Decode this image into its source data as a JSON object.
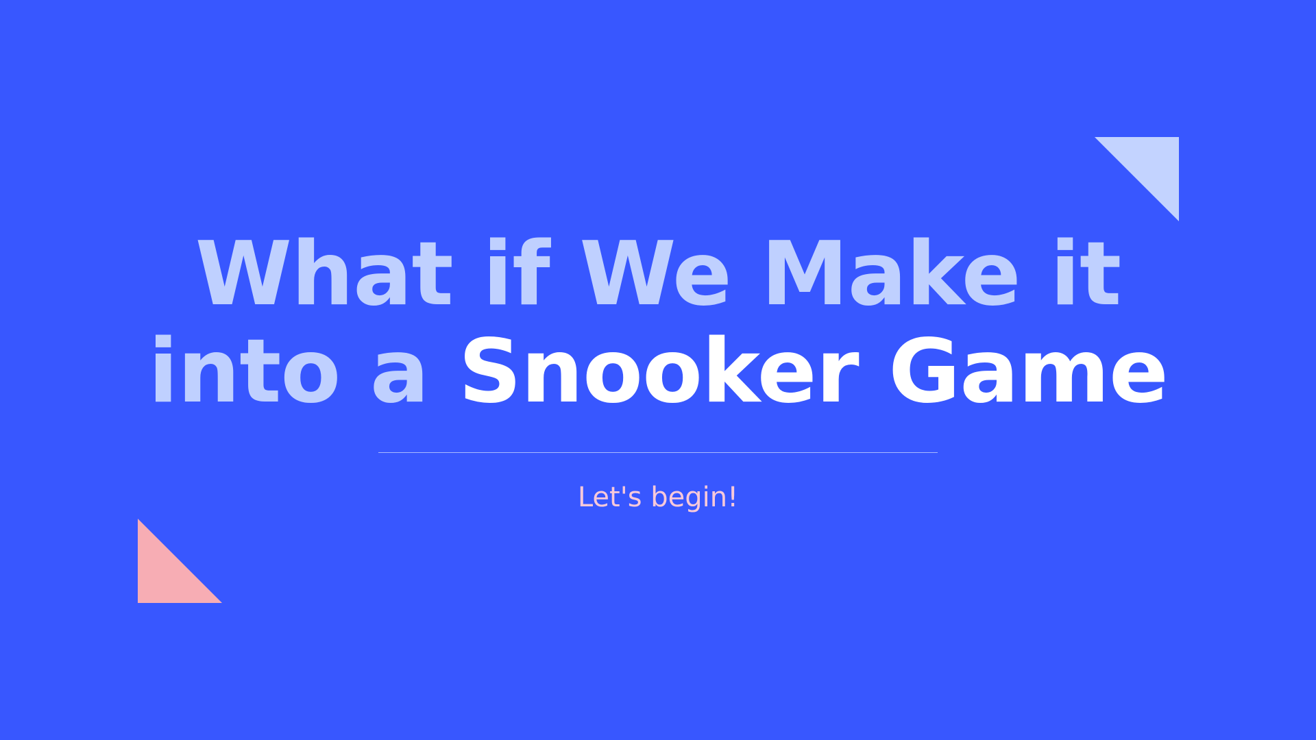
{
  "slide": {
    "title_line1": "What if We Make it",
    "title_line2_light": "into a",
    "title_line2_bold": "Snooker Game",
    "subtitle": "Let's begin!"
  },
  "colors": {
    "background": "#3857FF",
    "title_light": "#BFD0FF",
    "title_bold": "#FFFFFF",
    "subtitle": "#F8C9DA",
    "triangle_top_right": "#C3D3FF",
    "triangle_bottom_left": "#F7ADB4"
  }
}
